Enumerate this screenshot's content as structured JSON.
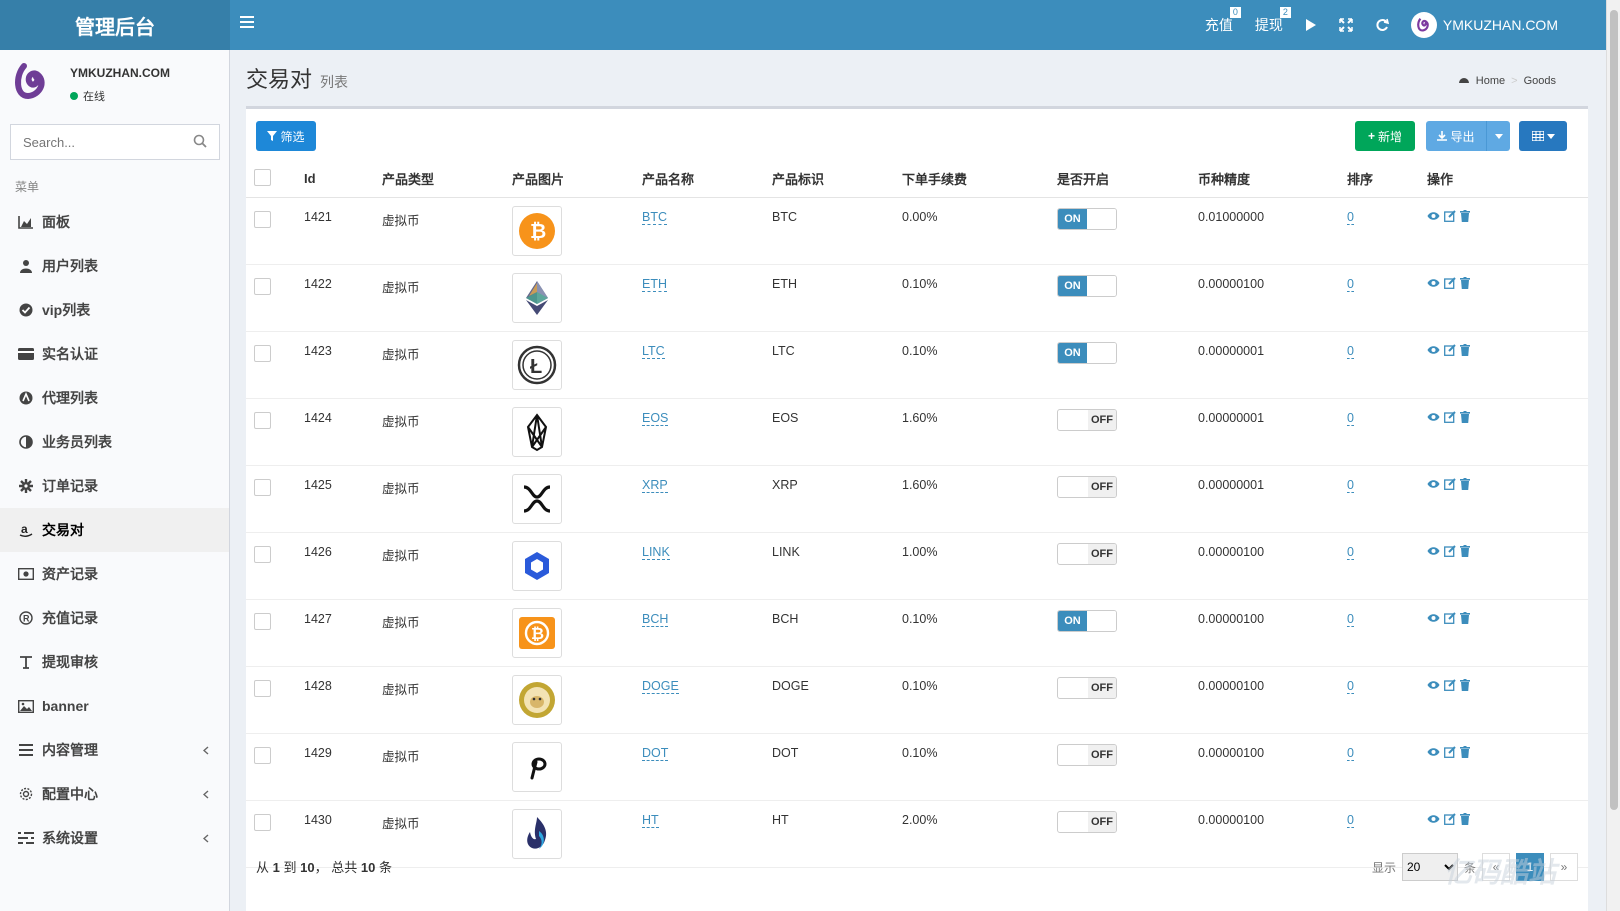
{
  "header": {
    "logo": "管理后台",
    "recharge_label": "充值",
    "recharge_badge": "0",
    "withdraw_label": "提现",
    "withdraw_badge": "2",
    "username": "YMKUZHAN.COM"
  },
  "sidebar": {
    "username": "YMKUZHAN.COM",
    "status": "在线",
    "search_placeholder": "Search...",
    "menu_header": "菜单",
    "items": [
      {
        "label": "面板",
        "icon": "area-chart-icon"
      },
      {
        "label": "用户列表",
        "icon": "user-icon"
      },
      {
        "label": "vip列表",
        "icon": "check-circle-icon"
      },
      {
        "label": "实名认证",
        "icon": "credit-card-icon"
      },
      {
        "label": "代理列表",
        "icon": "agent-icon"
      },
      {
        "label": "业务员列表",
        "icon": "adjust-icon"
      },
      {
        "label": "订单记录",
        "icon": "gear-icon"
      },
      {
        "label": "交易对",
        "icon": "amazon-icon",
        "active": true
      },
      {
        "label": "资产记录",
        "icon": "money-icon"
      },
      {
        "label": "充值记录",
        "icon": "registered-icon"
      },
      {
        "label": "提现审核",
        "icon": "text-icon"
      },
      {
        "label": "banner",
        "icon": "image-icon"
      },
      {
        "label": "内容管理",
        "icon": "list-icon",
        "chevron": true
      },
      {
        "label": "配置中心",
        "icon": "cog-icon",
        "chevron": true
      },
      {
        "label": "系统设置",
        "icon": "settings-list-icon",
        "chevron": true
      }
    ]
  },
  "page": {
    "title": "交易对",
    "subtitle": "列表",
    "breadcrumb_home": "Home",
    "breadcrumb_current": "Goods"
  },
  "toolbar": {
    "filter": "筛选",
    "add": "新增",
    "export": "导出"
  },
  "table": {
    "headers": [
      "Id",
      "产品类型",
      "产品图片",
      "产品名称",
      "产品标识",
      "下单手续费",
      "是否开启",
      "币种精度",
      "排序",
      "操作"
    ],
    "rows": [
      {
        "id": "1421",
        "type": "虚拟币",
        "name": "BTC",
        "symbol": "BTC",
        "fee": "0.00%",
        "enabled": true,
        "precision": "0.01000000",
        "sort": "0"
      },
      {
        "id": "1422",
        "type": "虚拟币",
        "name": "ETH",
        "symbol": "ETH",
        "fee": "0.10%",
        "enabled": true,
        "precision": "0.00000100",
        "sort": "0"
      },
      {
        "id": "1423",
        "type": "虚拟币",
        "name": "LTC",
        "symbol": "LTC",
        "fee": "0.10%",
        "enabled": true,
        "precision": "0.00000001",
        "sort": "0"
      },
      {
        "id": "1424",
        "type": "虚拟币",
        "name": "EOS",
        "symbol": "EOS",
        "fee": "1.60%",
        "enabled": false,
        "precision": "0.00000001",
        "sort": "0"
      },
      {
        "id": "1425",
        "type": "虚拟币",
        "name": "XRP",
        "symbol": "XRP",
        "fee": "1.60%",
        "enabled": false,
        "precision": "0.00000001",
        "sort": "0"
      },
      {
        "id": "1426",
        "type": "虚拟币",
        "name": "LINK",
        "symbol": "LINK",
        "fee": "1.00%",
        "enabled": false,
        "precision": "0.00000100",
        "sort": "0"
      },
      {
        "id": "1427",
        "type": "虚拟币",
        "name": "BCH",
        "symbol": "BCH",
        "fee": "0.10%",
        "enabled": true,
        "precision": "0.00000100",
        "sort": "0"
      },
      {
        "id": "1428",
        "type": "虚拟币",
        "name": "DOGE",
        "symbol": "DOGE",
        "fee": "0.10%",
        "enabled": false,
        "precision": "0.00000100",
        "sort": "0"
      },
      {
        "id": "1429",
        "type": "虚拟币",
        "name": "DOT",
        "symbol": "DOT",
        "fee": "0.10%",
        "enabled": false,
        "precision": "0.00000100",
        "sort": "0"
      },
      {
        "id": "1430",
        "type": "虚拟币",
        "name": "HT",
        "symbol": "HT",
        "fee": "2.00%",
        "enabled": false,
        "precision": "0.00000100",
        "sort": "0"
      }
    ],
    "switch_on": "ON",
    "switch_off": "OFF"
  },
  "footer": {
    "info_prefix": "从",
    "info_from": "1",
    "info_to_word": "到",
    "info_to": "10",
    "info_total_word": "， 总共",
    "info_total": "10",
    "info_suffix": "条",
    "show_label": "显示",
    "page_size": "20",
    "per_label": "条",
    "prev": "«",
    "page": "1",
    "next": "»"
  },
  "watermark": "亿码酷站",
  "colors": {
    "header": "#3c8dbc",
    "logo_bg": "#367fa9",
    "success": "#00a65a",
    "primary": "#1e88d8"
  }
}
